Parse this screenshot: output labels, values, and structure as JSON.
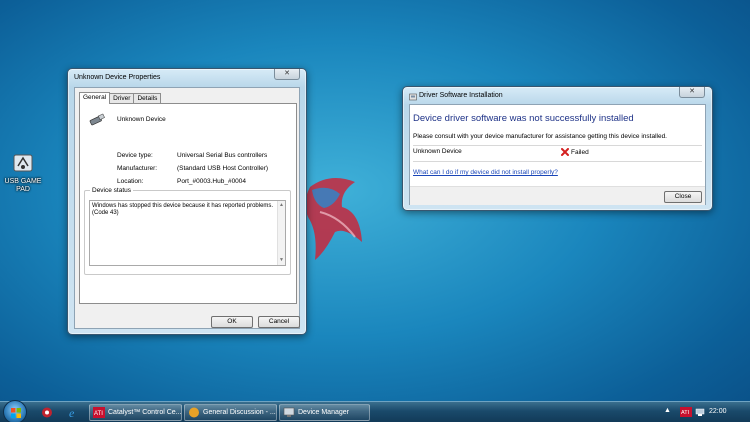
{
  "desktop": {
    "icon_label": "USB GAME PAD"
  },
  "props_window": {
    "title": "Unknown Device Properties",
    "close_glyph": "✕",
    "tabs": [
      {
        "label": "General"
      },
      {
        "label": "Driver"
      },
      {
        "label": "Details"
      }
    ],
    "device_name": "Unknown Device",
    "rows": [
      {
        "key": "Device type:",
        "value": "Universal Serial Bus controllers"
      },
      {
        "key": "Manufacturer:",
        "value": "(Standard USB Host Controller)"
      },
      {
        "key": "Location:",
        "value": "Port_#0003.Hub_#0004"
      }
    ],
    "status_title": "Device status",
    "status_text": "Windows has stopped this device because it has reported problems. (Code 43)",
    "ok_label": "OK",
    "cancel_label": "Cancel"
  },
  "driver_window": {
    "title": "Driver Software Installation",
    "close_glyph": "✕",
    "heading": "Device driver software was not successfully installed",
    "consult": "Please consult with your device manufacturer for assistance getting this device installed.",
    "device": "Unknown Device",
    "status": "Failed",
    "help_link": "What can I do if my device did not install properly?",
    "close_label": "Close"
  },
  "taskbar": {
    "buttons": [
      {
        "label": "Catalyst™ Control Ce..."
      },
      {
        "label": "General Discussion - ..."
      },
      {
        "label": "Device Manager"
      }
    ],
    "clock": "22:00"
  },
  "colors": {
    "heading_blue": "#1e3287",
    "link_blue": "#1a46b8",
    "failed_red": "#d42020"
  }
}
